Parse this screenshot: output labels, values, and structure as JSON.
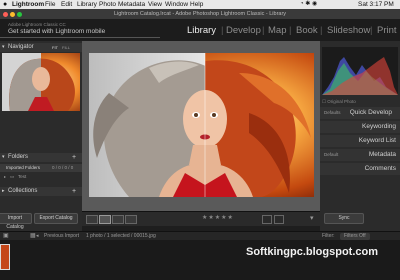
{
  "menubar": {
    "app": "Lightroom",
    "items": [
      "File",
      "Edit",
      "Library",
      "Photo",
      "Metadata",
      "View",
      "Window",
      "Help"
    ],
    "clock": "Sat 3:17 PM"
  },
  "window": {
    "title": "Lightroom Catalog.lrcat - Adobe Photoshop Lightroom Classic - Library"
  },
  "identity": {
    "line1": "Adobe Lightroom Classic CC",
    "line2": "Get started with Lightroom mobile"
  },
  "modules": [
    "Library",
    "Develop",
    "Map",
    "Book",
    "Slideshow",
    "Print"
  ],
  "left_panel": {
    "navigator": "Navigator",
    "nav_zoom": [
      "FIT",
      "FILL"
    ],
    "folders": "Folders",
    "imported": "Imported Folders",
    "imported_count": "0 / 0 / 0 / 0",
    "test_folder": "Test",
    "collections": "Collections",
    "import_btn": "Import Catalog",
    "export_btn": "Export Catalog"
  },
  "right_panel": {
    "histogram": "Histogram",
    "original_photo": "Original Photo",
    "defaults": "Defaults",
    "quick_develop": "Quick Develop",
    "keywording": "Keywording",
    "keyword_list": "Keyword List",
    "metadata": "Metadata",
    "metadata_preset": "Default",
    "comments": "Comments",
    "sync": "Sync"
  },
  "filmbar": {
    "previous_import": "Previous Import",
    "count": "1 photo / 1 selected / 00015.jpg",
    "filter_label": "Filter:",
    "filter_value": "Filters Off"
  },
  "watermark": "Softkingpc.blogspot.com",
  "colors": {
    "accent_active": "#e6e6e6",
    "panel": "#2b2b2b",
    "hair_left": "#b8b2a8",
    "hair_right": "#c2471a"
  }
}
